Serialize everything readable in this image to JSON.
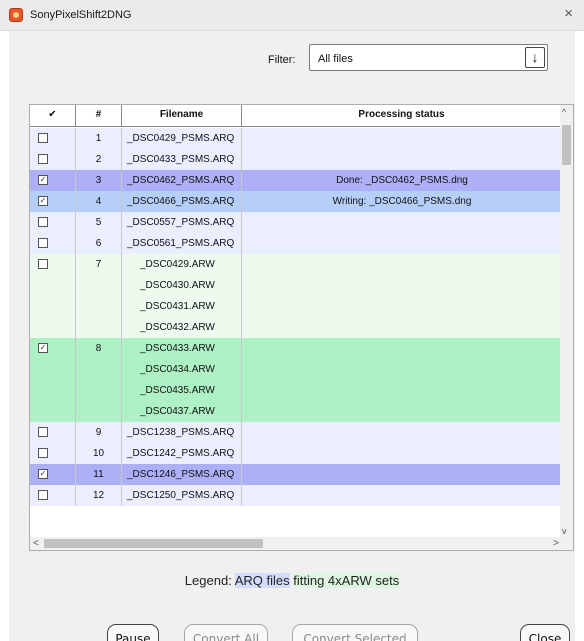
{
  "window": {
    "title": "SonyPixelShift2DNG",
    "close_glyph": "×",
    "icon": "app-icon"
  },
  "filter": {
    "label": "Filter:",
    "value": "All files",
    "arrow_glyph": "↓"
  },
  "table": {
    "headers": [
      "✔",
      "#",
      "Filename",
      "Processing status"
    ],
    "rows": [
      {
        "checked": false,
        "num": "1",
        "filename": "_DSC0429_PSMS.ARQ",
        "status": "",
        "kind": "arq"
      },
      {
        "checked": false,
        "num": "2",
        "filename": "_DSC0433_PSMS.ARQ",
        "status": "",
        "kind": "arq"
      },
      {
        "checked": true,
        "num": "3",
        "filename": "_DSC0462_PSMS.ARQ",
        "status": "Done: _DSC0462_PSMS.dng",
        "kind": "arq-done"
      },
      {
        "checked": true,
        "num": "4",
        "filename": "_DSC0466_PSMS.ARQ",
        "status": "Writing: _DSC0466_PSMS.dng",
        "kind": "arq-writing"
      },
      {
        "checked": false,
        "num": "5",
        "filename": "_DSC0557_PSMS.ARQ",
        "status": "",
        "kind": "arq"
      },
      {
        "checked": false,
        "num": "6",
        "filename": "_DSC0561_PSMS.ARQ",
        "status": "",
        "kind": "arq"
      },
      {
        "checked": false,
        "num": "7",
        "filename": "_DSC0429.ARW",
        "status": "",
        "kind": "arw"
      },
      {
        "checked": null,
        "num": "",
        "filename": "_DSC0430.ARW",
        "status": "",
        "kind": "arw"
      },
      {
        "checked": null,
        "num": "",
        "filename": "_DSC0431.ARW",
        "status": "",
        "kind": "arw"
      },
      {
        "checked": null,
        "num": "",
        "filename": "_DSC0432.ARW",
        "status": "",
        "kind": "arw"
      },
      {
        "checked": true,
        "num": "8",
        "filename": "_DSC0433.ARW",
        "status": "",
        "kind": "arw-selected"
      },
      {
        "checked": null,
        "num": "",
        "filename": "_DSC0434.ARW",
        "status": "",
        "kind": "arw-selected"
      },
      {
        "checked": null,
        "num": "",
        "filename": "_DSC0435.ARW",
        "status": "",
        "kind": "arw-selected"
      },
      {
        "checked": null,
        "num": "",
        "filename": "_DSC0437.ARW",
        "status": "",
        "kind": "arw-selected"
      },
      {
        "checked": false,
        "num": "9",
        "filename": "_DSC1238_PSMS.ARQ",
        "status": "",
        "kind": "arq"
      },
      {
        "checked": false,
        "num": "10",
        "filename": "_DSC1242_PSMS.ARQ",
        "status": "",
        "kind": "arq"
      },
      {
        "checked": true,
        "num": "11",
        "filename": "_DSC1246_PSMS.ARQ",
        "status": "",
        "kind": "arq-done"
      },
      {
        "checked": false,
        "num": "12",
        "filename": "_DSC1250_PSMS.ARQ",
        "status": "",
        "kind": "arq"
      }
    ],
    "checkmark_glyph": "✓",
    "scroll_up_glyph": "^",
    "scroll_down_glyph": "v",
    "scroll_left_glyph": "<",
    "scroll_right_glyph": ">"
  },
  "legend": {
    "prefix": "Legend:",
    "arq_label": "ARQ files",
    "arw_label": "fitting 4xARW sets"
  },
  "buttons": {
    "pause": "Pause",
    "convert_all": "Convert All",
    "convert_selected": "Convert Selected",
    "close": "Close"
  },
  "colors": {
    "arq": "#ebeeff",
    "arq-done": "#adb0f7",
    "arq-writing": "#b5cff8",
    "arw": "#ecfbee",
    "arw-selected": "#adf1c4",
    "legend_arq": "#d6dcff",
    "legend_arw": "#ddf5e1"
  }
}
